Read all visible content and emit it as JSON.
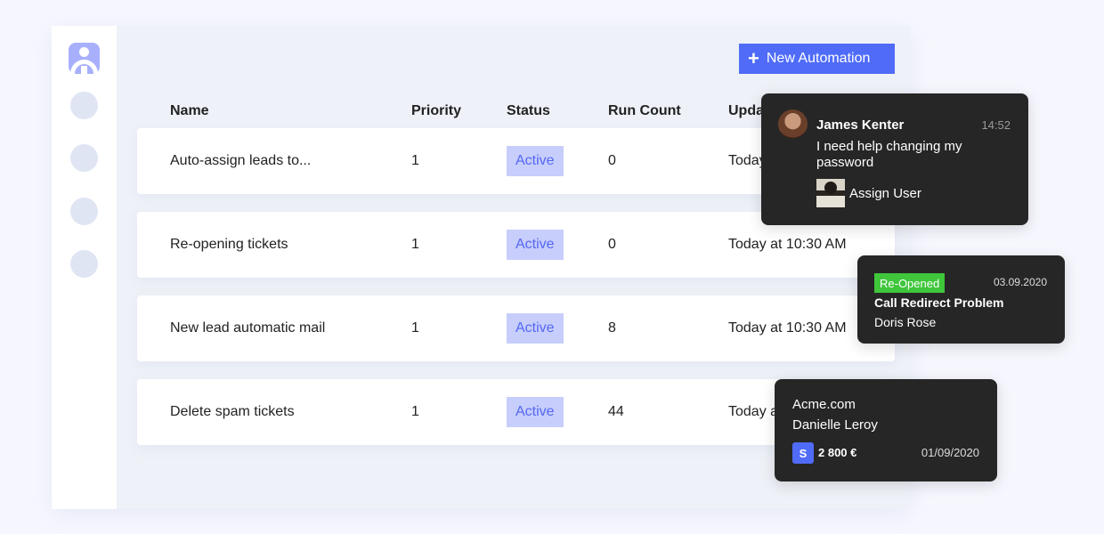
{
  "sidebar": {
    "logo": "user-logo-icon",
    "nav_items": [
      "nav-item-1",
      "nav-item-2",
      "nav-item-3",
      "nav-item-4"
    ]
  },
  "toolbar": {
    "new_label": "New Automation",
    "new_icon": "plus-icon"
  },
  "table": {
    "columns": [
      "Name",
      "Priority",
      "Status",
      "Run Count",
      "Updated"
    ],
    "rows": [
      {
        "name": "Auto-assign leads to...",
        "priority": "1",
        "status": "Active",
        "run_count": "0",
        "updated": "Today at 10:30 AM"
      },
      {
        "name": "Re-opening tickets",
        "priority": "1",
        "status": "Active",
        "run_count": "0",
        "updated": "Today at 10:30 AM"
      },
      {
        "name": "New lead automatic mail",
        "priority": "1",
        "status": "Active",
        "run_count": "8",
        "updated": "Today at 10:30 AM"
      },
      {
        "name": "Delete spam tickets",
        "priority": "1",
        "status": "Active",
        "run_count": "44",
        "updated": "Today at 10:30 AM"
      }
    ]
  },
  "chat_card": {
    "name": "James Kenter",
    "time": "14:52",
    "message": "I need help changing my password",
    "action": "Assign User"
  },
  "ticket_card": {
    "tag": "Re-Opened",
    "tag_color": "#3fc63b",
    "date": "03.09.2020",
    "title": "Call Redirect Problem",
    "person": "Doris Rose"
  },
  "deal_card": {
    "company": "Acme.com",
    "contact": "Danielle Leroy",
    "badge": "S",
    "amount": "2 800 €",
    "date": "01/09/2020"
  },
  "colors": {
    "accent": "#4f6bf8",
    "badge_bg": "#c7cefc",
    "badge_text": "#5467f1",
    "card_bg": "#262626"
  }
}
